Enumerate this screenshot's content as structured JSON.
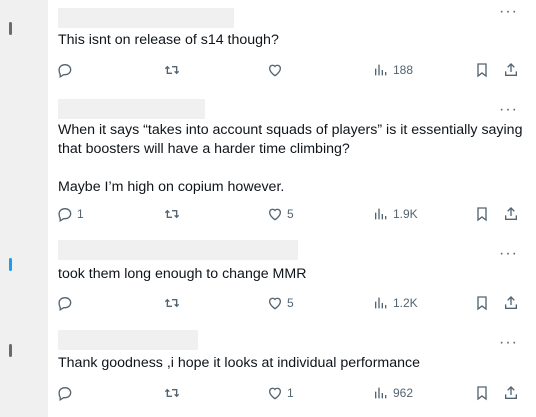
{
  "tweets": [
    {
      "lines": [
        "This isnt on release of s14 though?"
      ],
      "reply_count": "",
      "retweet_count": "",
      "like_count": "",
      "view_count": "188"
    },
    {
      "lines": [
        "When it says “takes into account squads of players” is it essentially saying",
        "that boosters will have a harder time climbing?",
        "",
        "Maybe I’m high on copium however."
      ],
      "reply_count": "1",
      "retweet_count": "",
      "like_count": "5",
      "view_count": "1.9K"
    },
    {
      "lines": [
        "took them long enough to change MMR"
      ],
      "reply_count": "",
      "retweet_count": "",
      "like_count": "5",
      "view_count": "1.2K"
    },
    {
      "lines": [
        "Thank goodness ,i hope it looks at individual performance"
      ],
      "reply_count": "",
      "retweet_count": "",
      "like_count": "1",
      "view_count": "962"
    }
  ],
  "more_glyph": "···",
  "icons": [
    "reply-icon",
    "retweet-icon",
    "like-icon",
    "views-icon",
    "bookmark-icon",
    "share-icon"
  ],
  "colors": {
    "text": "#0f1419",
    "muted": "#536471",
    "divider": "#eff3f4",
    "redaction": "#f0f0f0"
  }
}
